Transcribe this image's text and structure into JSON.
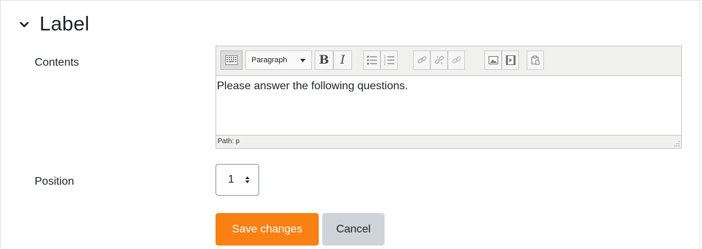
{
  "section": {
    "title": "Label",
    "icon": "chevron-down-icon"
  },
  "fields": {
    "contents_label": "Contents",
    "position_label": "Position"
  },
  "editor": {
    "toolbar": {
      "format_select": "Paragraph",
      "bold": "B",
      "italic": "I",
      "icons": [
        "toggle-toolbar-icon",
        "format-select",
        "bold-icon",
        "italic-icon",
        "unordered-list-icon",
        "ordered-list-icon",
        "link-icon",
        "unlink-icon",
        "no-autolink-icon",
        "image-icon",
        "media-icon",
        "paste-text-icon"
      ]
    },
    "content": "Please answer the following questions.",
    "path": "Path: p"
  },
  "position": {
    "value": "1"
  },
  "buttons": {
    "save": "Save changes",
    "cancel": "Cancel"
  },
  "colors": {
    "primary": "#f98012",
    "secondary": "#ced4da"
  }
}
